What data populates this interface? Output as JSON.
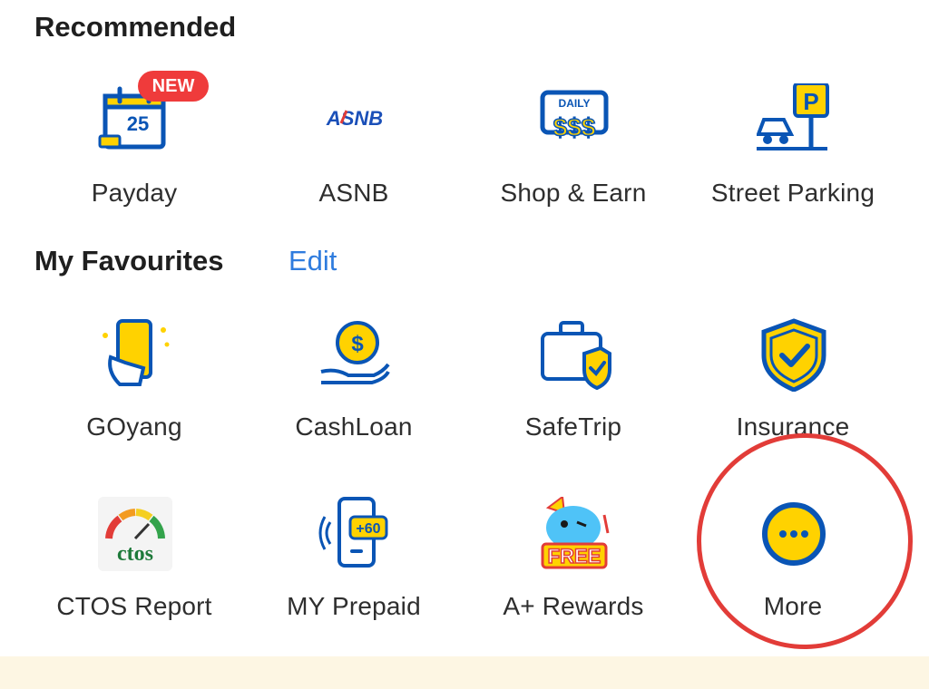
{
  "recommended": {
    "title": "Recommended",
    "items": [
      {
        "label": "Payday",
        "icon": "calendar-25-icon",
        "badge": "NEW"
      },
      {
        "label": "ASNB",
        "icon": "asnb-logo-icon",
        "logo_text": "ASNB"
      },
      {
        "label": "Shop & Earn",
        "icon": "daily-dollar-icon",
        "logo_text": "DAILY",
        "amount_text": "$$$"
      },
      {
        "label": "Street Parking",
        "icon": "street-parking-icon",
        "sign_text": "P"
      }
    ]
  },
  "favourites": {
    "title": "My Favourites",
    "edit_label": "Edit",
    "items": [
      {
        "label": "GOyang",
        "icon": "phone-hand-icon"
      },
      {
        "label": "CashLoan",
        "icon": "cash-coin-hand-icon",
        "coin_text": "$"
      },
      {
        "label": "SafeTrip",
        "icon": "luggage-shield-icon"
      },
      {
        "label": "Insurance",
        "icon": "shield-check-icon"
      },
      {
        "label": "CTOS Report",
        "icon": "ctos-logo-icon",
        "logo_text": "ctos"
      },
      {
        "label": "MY Prepaid",
        "icon": "prepaid-phone-icon",
        "bubble_text": "+60"
      },
      {
        "label": "A+ Rewards",
        "icon": "free-mascot-icon",
        "logo_text": "FREE"
      },
      {
        "label": "More",
        "icon": "more-dots-icon"
      }
    ]
  },
  "colors": {
    "brand_blue": "#0a55b5",
    "brand_yellow": "#ffd200",
    "link_blue": "#2f7cde",
    "badge_red": "#ef3b3b",
    "annotation_red": "#e23c38",
    "banner_cream": "#fdf6e3"
  }
}
